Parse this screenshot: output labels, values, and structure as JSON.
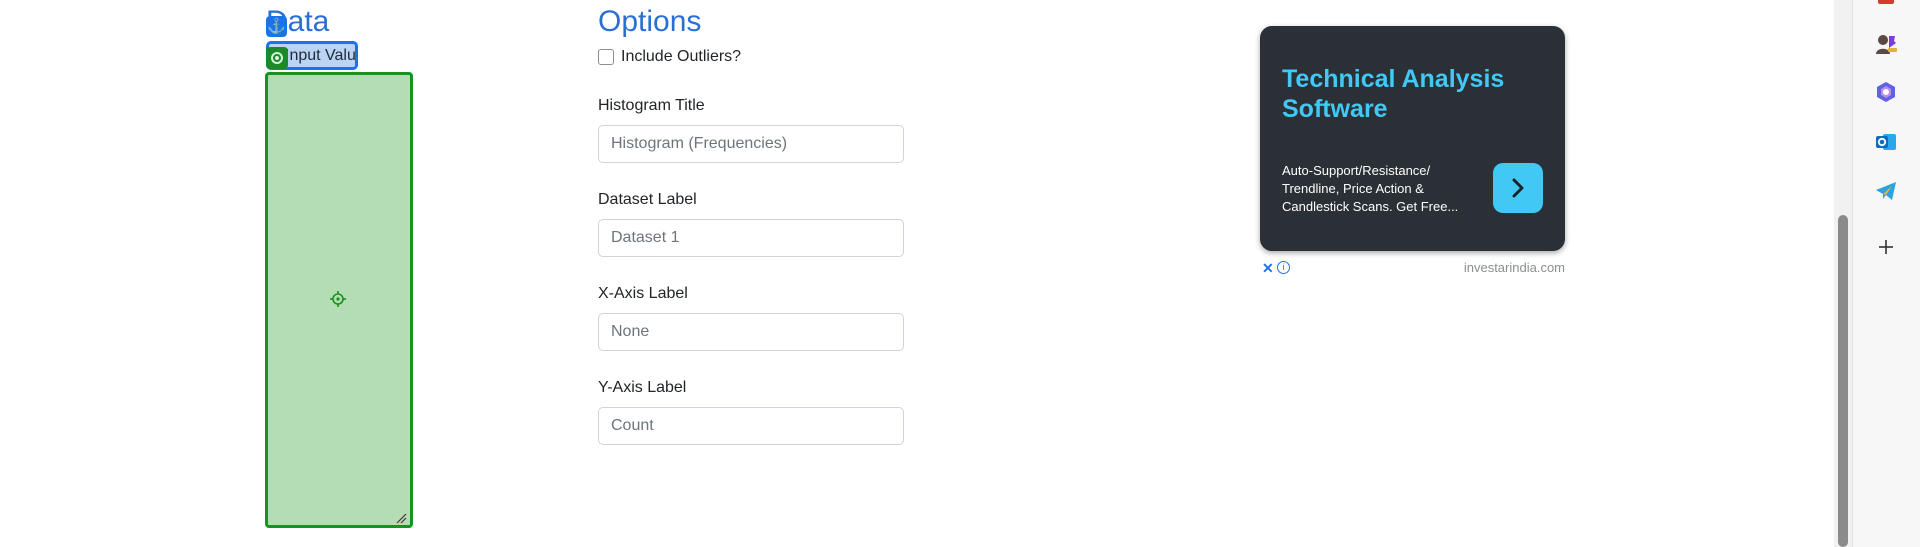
{
  "data_section": {
    "heading": "Data",
    "input_label": "Input Values"
  },
  "options_section": {
    "heading": "Options",
    "include_outliers": {
      "label": "Include Outliers?",
      "checked": false
    },
    "histogram_title": {
      "label": "Histogram Title",
      "placeholder": "Histogram (Frequencies)"
    },
    "dataset_label": {
      "label": "Dataset Label",
      "placeholder": "Dataset 1"
    },
    "x_axis_label": {
      "label": "X-Axis Label",
      "placeholder": "None"
    },
    "y_axis_label": {
      "label": "Y-Axis Label",
      "placeholder": "Count"
    }
  },
  "ad": {
    "title": "Technical Analysis Software",
    "body": "Auto-Support/Resistance/ Trendline, Price Action & Candlestick Scans. Get Free...",
    "domain": "investarindia.com",
    "close_glyph": "✕",
    "info_glyph": "i"
  },
  "colors": {
    "heading_blue": "#2a6fd6",
    "highlight_green": "#16941f",
    "highlight_blue": "#1a73e8",
    "ad_accent": "#41c8f5"
  },
  "sidebar_icons": [
    "person-chess-icon",
    "copilot-icon",
    "outlook-icon",
    "telegram-icon",
    "add-icon"
  ]
}
